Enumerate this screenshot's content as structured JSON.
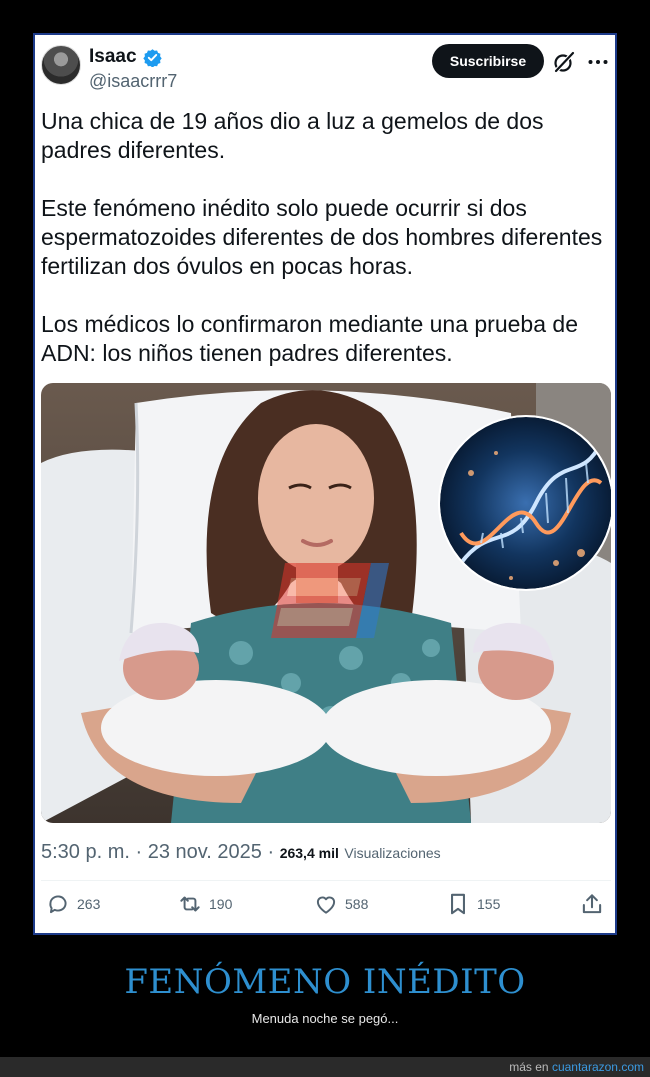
{
  "tweet": {
    "author": {
      "name": "Isaac",
      "handle": "@isaacrrr7"
    },
    "subscribe_label": "Suscribirse",
    "paragraphs": [
      "Una chica de 19 años dio a luz a gemelos de dos padres diferentes.",
      "Este fenómeno inédito solo puede ocurrir si dos espermatozoides diferentes de dos hombres diferentes fertilizan dos óvulos en pocas horas.",
      "Los médicos lo confirmaron mediante una prueba de ADN: los niños tienen padres diferentes."
    ],
    "time": "5:30 p. m.",
    "separator": "·",
    "date": "23 nov. 2025",
    "views_count": "263,4 mil",
    "views_label": "Visualizaciones",
    "actions": {
      "replies": "263",
      "reposts": "190",
      "likes": "588",
      "bookmarks": "155"
    }
  },
  "footer": {
    "title": "FENÓMENO INÉDITO",
    "subtitle": "Menuda noche se pegó...",
    "credit_prefix": "más en",
    "credit_site": "cuantarazon.com"
  },
  "colors": {
    "page_background": "#000000",
    "card_border": "#1d3b8a",
    "verified": "#1d9bf0",
    "footer_title": "#2e8fcf",
    "subscribe_button": "#0f1419"
  },
  "icons": [
    "verified-icon",
    "grok-icon",
    "more-icon",
    "reply-icon",
    "repost-icon",
    "like-icon",
    "bookmark-icon",
    "share-icon"
  ]
}
